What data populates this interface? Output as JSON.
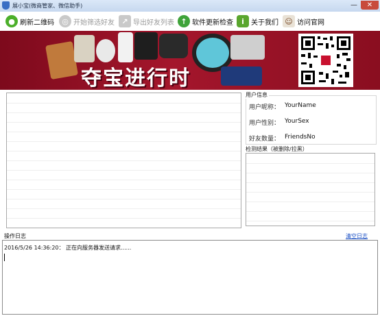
{
  "window": {
    "title": "展小宝(微商管家、微信助手)",
    "minimize_glyph": "—",
    "close_glyph": "✕"
  },
  "toolbar": {
    "items": [
      {
        "label": "刷新二维码",
        "icon": "wechat-icon",
        "enabled": true
      },
      {
        "label": "开始筛选好友",
        "icon": "disc-icon",
        "enabled": false
      },
      {
        "label": "导出好友列表",
        "icon": "export-icon",
        "enabled": false
      },
      {
        "label": "软件更新检查",
        "icon": "up-arrow-icon",
        "enabled": true
      },
      {
        "label": "关于我们",
        "icon": "info-icon",
        "enabled": true
      },
      {
        "label": "访问官网",
        "icon": "avatar-icon",
        "enabled": true
      }
    ]
  },
  "banner": {
    "slogan": "夺宝进行时"
  },
  "user_info": {
    "title": "用户信息",
    "nickname_label": "用户昵称：",
    "nickname_value": "YourName",
    "sex_label": "用户性别：",
    "sex_value": "YourSex",
    "friends_label": "好友数量：",
    "friends_value": "FriendsNo"
  },
  "check_result": {
    "title": "检测结果（被删除/拉黑）"
  },
  "log": {
    "title": "操作日志",
    "clear_label": "清空日志",
    "entries": [
      "2016/5/26 14:36:20： 正在向服务器发送请求......"
    ]
  },
  "colors": {
    "banner_red": "#a4162c",
    "link_blue": "#1a4fc4",
    "toolbar_green": "#4caf2a"
  }
}
